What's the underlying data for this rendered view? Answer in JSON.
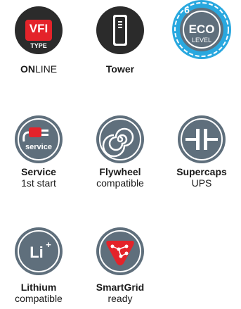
{
  "colors": {
    "dark": "#2b2b2b",
    "red": "#e4232a",
    "grey": "#5f6f7c",
    "blue": "#29a8df",
    "white": "#ffffff"
  },
  "row1": {
    "vfi": {
      "icon": "vfi-type-badge-icon",
      "badge_top": "VFI",
      "badge_bottom": "TYPE",
      "label_bold": "ON",
      "label_rest": "LINE"
    },
    "tower": {
      "icon": "tower-ups-icon",
      "label": "Tower"
    },
    "eco": {
      "icon": "eco-level-icon",
      "level": "6",
      "eco_text": "ECO",
      "level_text": "LEVEL"
    }
  },
  "row2": {
    "service": {
      "icon": "service-plug-icon",
      "badge_text": "service",
      "label_line1": "Service",
      "label_line2": "1st start"
    },
    "flywheel": {
      "icon": "flywheel-spiral-icon",
      "label_line1": "Flywheel",
      "label_line2": "compatible"
    },
    "supercaps": {
      "icon": "capacitor-icon",
      "label_line1": "Supercaps",
      "label_line2": "UPS"
    }
  },
  "row3": {
    "lithium": {
      "icon": "lithium-ion-icon",
      "badge_text": "Li",
      "badge_sup": "+",
      "label_line1": "Lithium",
      "label_line2": "compatible"
    },
    "smartgrid": {
      "icon": "smartgrid-network-icon",
      "label_line1": "SmartGrid",
      "label_line2": "ready"
    }
  }
}
